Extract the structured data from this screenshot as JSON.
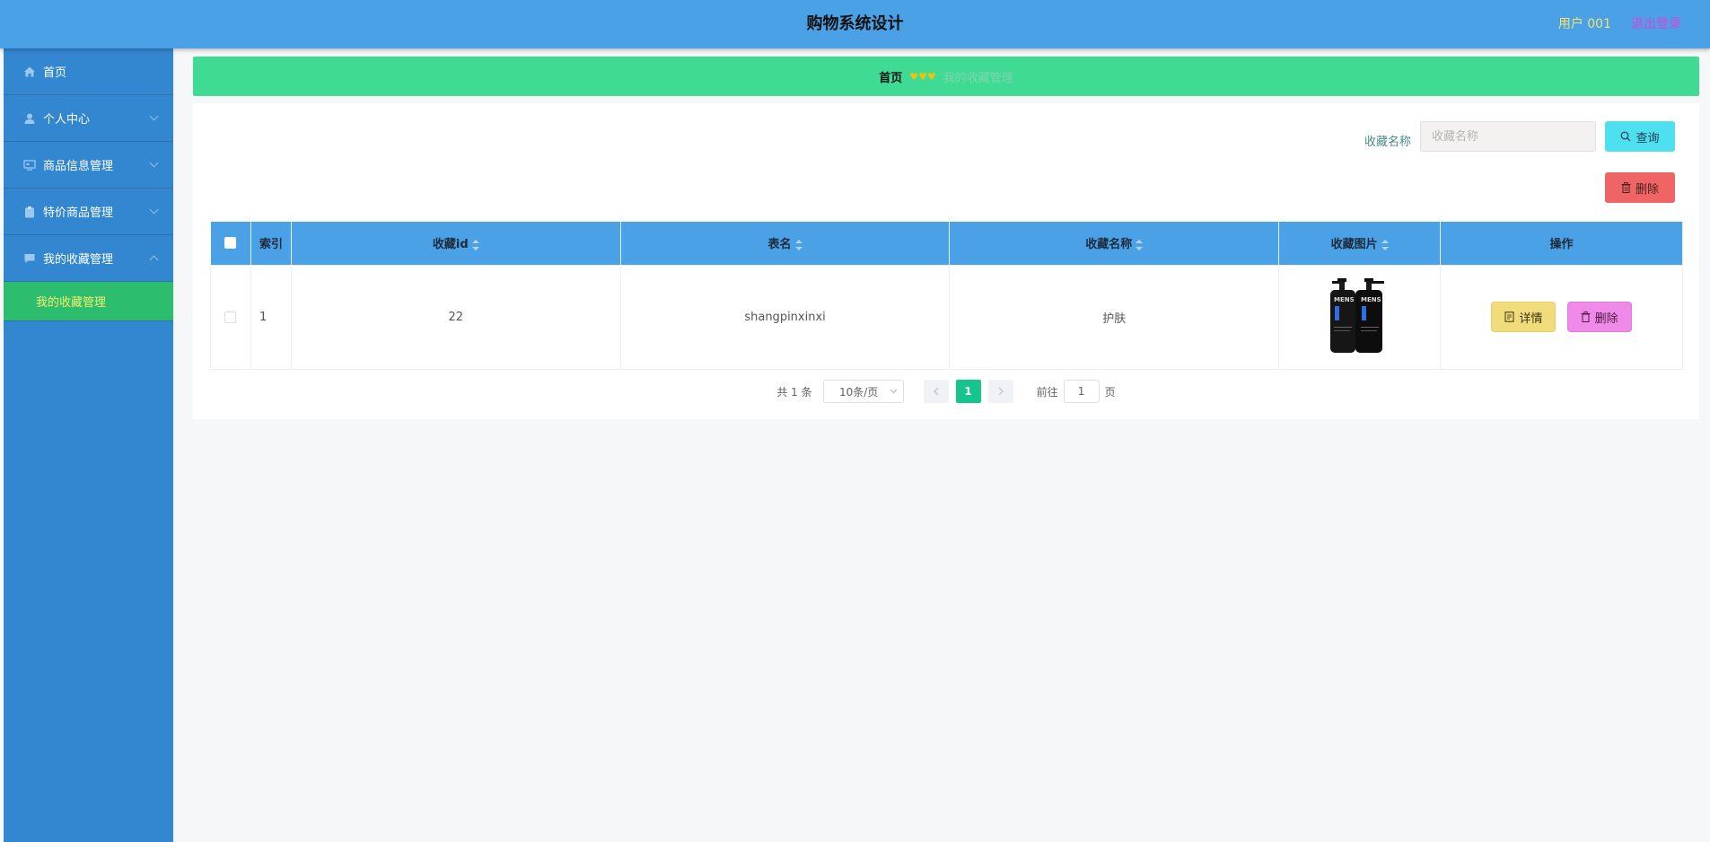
{
  "header": {
    "title": "购物系统设计",
    "user": "用户 001",
    "logout": "退出登录"
  },
  "sidebar": {
    "items": [
      {
        "label": "首页",
        "icon": "home-icon"
      },
      {
        "label": "个人中心",
        "icon": "user-icon"
      },
      {
        "label": "商品信息管理",
        "icon": "monitor-icon"
      },
      {
        "label": "特价商品管理",
        "icon": "clipboard-icon"
      },
      {
        "label": "我的收藏管理",
        "icon": "chat-icon"
      }
    ],
    "subitem": "我的收藏管理"
  },
  "breadcrumb": {
    "home": "首页",
    "separator": "♥♥♥",
    "current": "我的收藏管理"
  },
  "search": {
    "label": "收藏名称",
    "placeholder": "收藏名称",
    "query_button": "查询",
    "delete_button": "删除"
  },
  "table": {
    "headers": {
      "index": "索引",
      "id": "收藏id",
      "table_name": "表名",
      "name": "收藏名称",
      "image": "收藏图片",
      "actions": "操作"
    },
    "rows": [
      {
        "index": "1",
        "id": "22",
        "table_name": "shangpinxinxi",
        "name": "护肤",
        "image_text": "MENS"
      }
    ],
    "detail_button": "详情",
    "delete_button": "删除"
  },
  "pagination": {
    "total": "共 1 条",
    "page_size": "10条/页",
    "current_page": "1",
    "goto_label": "前往",
    "goto_value": "1",
    "page_suffix": "页"
  },
  "colors": {
    "header": "#4aa1e6",
    "sidebar": "#3387d0",
    "active_submenu": "#2dbd6e",
    "breadcrumb": "#3fdb95",
    "page_active": "#16c48e"
  }
}
